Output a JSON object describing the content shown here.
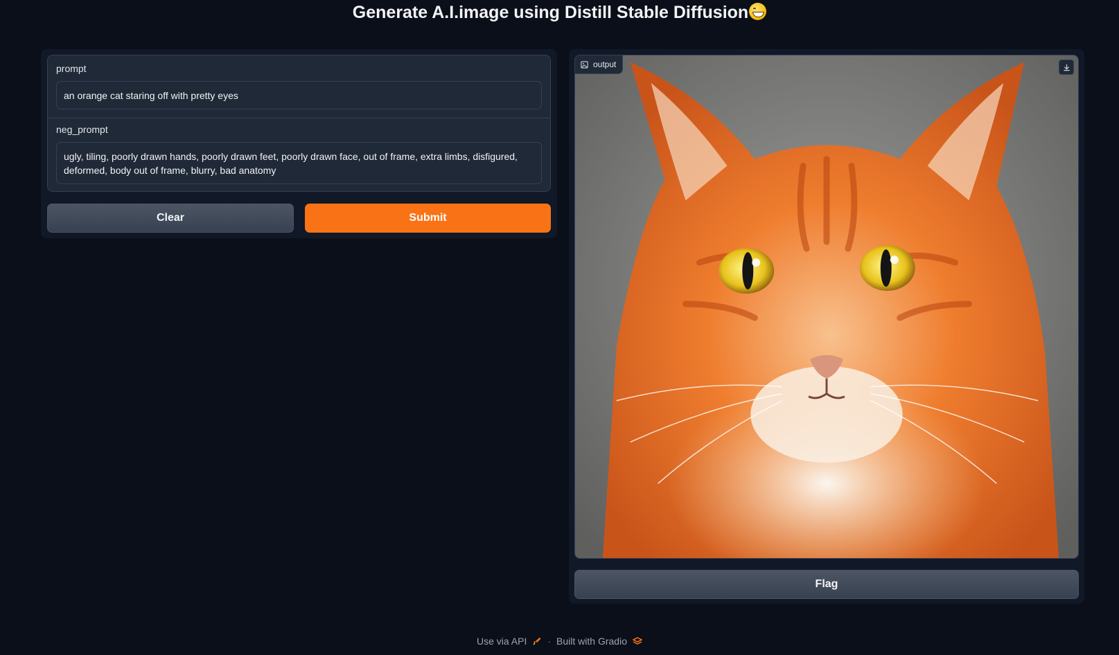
{
  "header": {
    "title": "Generate A.I.image using Distill Stable Diffusion"
  },
  "inputs": {
    "prompt": {
      "label": "prompt",
      "value": "an orange cat staring off with pretty eyes"
    },
    "neg_prompt": {
      "label": "neg_prompt",
      "value": "ugly, tiling, poorly drawn hands, poorly drawn feet, poorly drawn face, out of frame, extra limbs, disfigured, deformed, body out of frame, blurry, bad anatomy"
    }
  },
  "buttons": {
    "clear": "Clear",
    "submit": "Submit",
    "flag": "Flag"
  },
  "output": {
    "label": "output",
    "image_subject": "orange cat portrait"
  },
  "footer": {
    "api": "Use via API",
    "separator": "·",
    "built": "Built with Gradio"
  },
  "colors": {
    "background": "#0b0f19",
    "panel": "#111827",
    "accent": "#f97316"
  },
  "icons": [
    "image-icon",
    "download-icon",
    "rocket-icon",
    "gradio-logo-icon",
    "grin-emoji-icon"
  ]
}
